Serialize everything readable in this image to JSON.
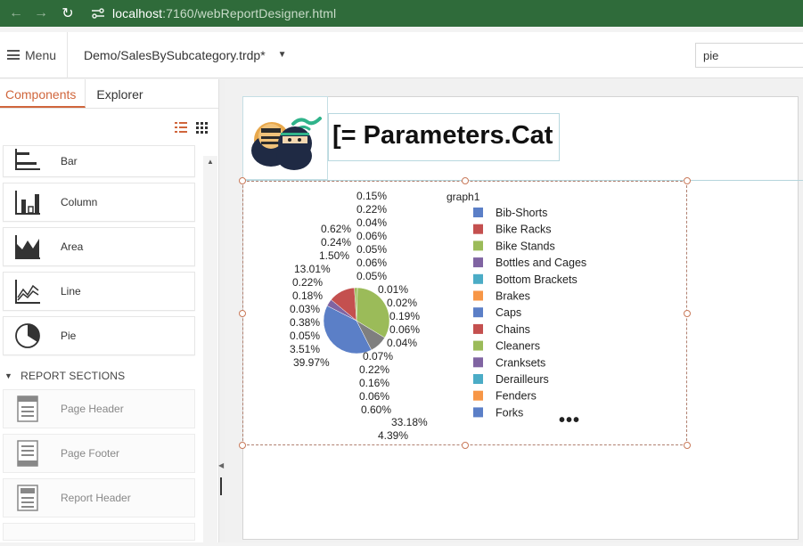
{
  "browser": {
    "url_host": "localhost",
    "url_path": ":7160/webReportDesigner.html"
  },
  "toolbar": {
    "menu_label": "Menu",
    "document_title": "Demo/SalesBySubcategory.trdp*",
    "search_value": "pie"
  },
  "left_panel": {
    "tabs": [
      "Components",
      "Explorer"
    ],
    "components": [
      {
        "label": "Bar",
        "icon": "bar-chart-icon"
      },
      {
        "label": "Column",
        "icon": "column-chart-icon"
      },
      {
        "label": "Area",
        "icon": "area-chart-icon"
      },
      {
        "label": "Line",
        "icon": "line-chart-icon"
      },
      {
        "label": "Pie",
        "icon": "pie-chart-icon"
      }
    ],
    "section_title": "REPORT SECTIONS",
    "sections": [
      {
        "label": "Page Header",
        "icon": "page-header-icon"
      },
      {
        "label": "Page Footer",
        "icon": "page-footer-icon"
      },
      {
        "label": "Report Header",
        "icon": "report-header-icon"
      }
    ]
  },
  "report": {
    "title_expression": "[= Parameters.Cat",
    "ellipsis": "•••"
  },
  "chart_data": {
    "type": "pie",
    "legend_title": "graph1",
    "legend_position": "right",
    "legend": [
      "Bib-Shorts",
      "Bike Racks",
      "Bike Stands",
      "Bottles and Cages",
      "Bottom Brackets",
      "Brakes",
      "Caps",
      "Chains",
      "Cleaners",
      "Cranksets",
      "Derailleurs",
      "Fenders",
      "Forks"
    ],
    "colors": [
      "#5b7fc7",
      "#c4504f",
      "#9bbb59",
      "#8064a2",
      "#4bacc6",
      "#f79646",
      "#5b7fc7",
      "#c4504f",
      "#9bbb59",
      "#8064a2",
      "#4bacc6",
      "#f79646",
      "#5b7fc7"
    ],
    "slices": [
      {
        "percent": 39.97,
        "color": "#5b7fc7"
      },
      {
        "percent": 3.51,
        "color": "#8064a2"
      },
      {
        "percent": 13.01,
        "color": "#c4504f"
      },
      {
        "percent": 1.5,
        "color": "#9bbb59"
      },
      {
        "percent": 33.18,
        "color": "#9bbb59"
      },
      {
        "percent": 8.83,
        "color": "#7f7f7f"
      }
    ],
    "labels": [
      "0.15%",
      "0.22%",
      "0.04%",
      "0.06%",
      "0.05%",
      "0.06%",
      "0.05%",
      "0.62%",
      "0.24%",
      "1.50%",
      "13.01%",
      "0.22%",
      "0.18%",
      "0.03%",
      "0.38%",
      "0.05%",
      "3.51%",
      "39.97%",
      "0.01%",
      "0.02%",
      "0.19%",
      "0.06%",
      "0.04%",
      "0.07%",
      "0.22%",
      "0.16%",
      "0.06%",
      "0.60%",
      "33.18%",
      "4.39%"
    ]
  }
}
